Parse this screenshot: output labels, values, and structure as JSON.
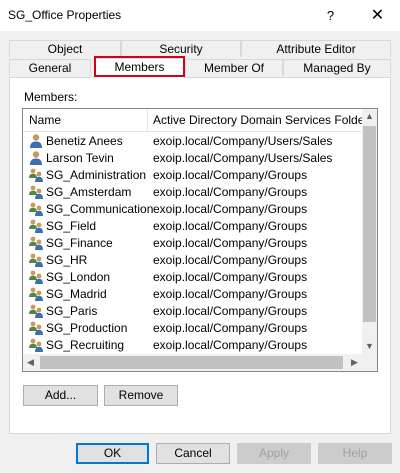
{
  "window": {
    "title": "SG_Office Properties",
    "help_glyph": "?",
    "close_glyph": "✕"
  },
  "tabs_top": [
    {
      "label": "Object"
    },
    {
      "label": "Security"
    },
    {
      "label": "Attribute Editor"
    }
  ],
  "tabs_bottom": [
    {
      "label": "General"
    },
    {
      "label": "Members"
    },
    {
      "label": "Member Of"
    },
    {
      "label": "Managed By"
    }
  ],
  "active_tab": "Members",
  "panel": {
    "members_label": "Members:",
    "columns": {
      "name": "Name",
      "folder": "Active Directory Domain Services Folder"
    },
    "rows": [
      {
        "name": "Benetiz Anees",
        "folder": "exoip.local/Company/Users/Sales",
        "type": "user"
      },
      {
        "name": "Larson Tevin",
        "folder": "exoip.local/Company/Users/Sales",
        "type": "user"
      },
      {
        "name": "SG_Administration",
        "folder": "exoip.local/Company/Groups",
        "type": "group"
      },
      {
        "name": "SG_Amsterdam",
        "folder": "exoip.local/Company/Groups",
        "type": "group"
      },
      {
        "name": "SG_Communication",
        "folder": "exoip.local/Company/Groups",
        "type": "group"
      },
      {
        "name": "SG_Field",
        "folder": "exoip.local/Company/Groups",
        "type": "group"
      },
      {
        "name": "SG_Finance",
        "folder": "exoip.local/Company/Groups",
        "type": "group"
      },
      {
        "name": "SG_HR",
        "folder": "exoip.local/Company/Groups",
        "type": "group"
      },
      {
        "name": "SG_London",
        "folder": "exoip.local/Company/Groups",
        "type": "group"
      },
      {
        "name": "SG_Madrid",
        "folder": "exoip.local/Company/Groups",
        "type": "group"
      },
      {
        "name": "SG_Paris",
        "folder": "exoip.local/Company/Groups",
        "type": "group"
      },
      {
        "name": "SG_Production",
        "folder": "exoip.local/Company/Groups",
        "type": "group"
      },
      {
        "name": "SG_Recruiting",
        "folder": "exoip.local/Company/Groups",
        "type": "group"
      }
    ],
    "add_label": "Add...",
    "remove_label": "Remove"
  },
  "footer": {
    "ok_label": "OK",
    "cancel_label": "Cancel",
    "apply_label": "Apply",
    "help_label": "Help"
  },
  "colors": {
    "highlight": "#d0021b",
    "accent": "#0078d7"
  }
}
